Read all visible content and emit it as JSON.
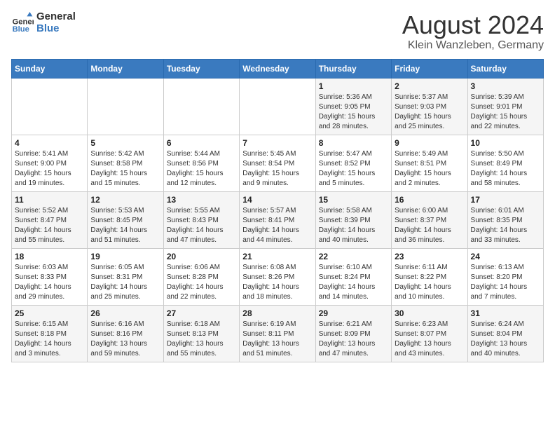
{
  "logo": {
    "line1": "General",
    "line2": "Blue"
  },
  "title": "August 2024",
  "subtitle": "Klein Wanzleben, Germany",
  "days_of_week": [
    "Sunday",
    "Monday",
    "Tuesday",
    "Wednesday",
    "Thursday",
    "Friday",
    "Saturday"
  ],
  "weeks": [
    [
      {
        "day": "",
        "info": ""
      },
      {
        "day": "",
        "info": ""
      },
      {
        "day": "",
        "info": ""
      },
      {
        "day": "",
        "info": ""
      },
      {
        "day": "1",
        "info": "Sunrise: 5:36 AM\nSunset: 9:05 PM\nDaylight: 15 hours\nand 28 minutes."
      },
      {
        "day": "2",
        "info": "Sunrise: 5:37 AM\nSunset: 9:03 PM\nDaylight: 15 hours\nand 25 minutes."
      },
      {
        "day": "3",
        "info": "Sunrise: 5:39 AM\nSunset: 9:01 PM\nDaylight: 15 hours\nand 22 minutes."
      }
    ],
    [
      {
        "day": "4",
        "info": "Sunrise: 5:41 AM\nSunset: 9:00 PM\nDaylight: 15 hours\nand 19 minutes."
      },
      {
        "day": "5",
        "info": "Sunrise: 5:42 AM\nSunset: 8:58 PM\nDaylight: 15 hours\nand 15 minutes."
      },
      {
        "day": "6",
        "info": "Sunrise: 5:44 AM\nSunset: 8:56 PM\nDaylight: 15 hours\nand 12 minutes."
      },
      {
        "day": "7",
        "info": "Sunrise: 5:45 AM\nSunset: 8:54 PM\nDaylight: 15 hours\nand 9 minutes."
      },
      {
        "day": "8",
        "info": "Sunrise: 5:47 AM\nSunset: 8:52 PM\nDaylight: 15 hours\nand 5 minutes."
      },
      {
        "day": "9",
        "info": "Sunrise: 5:49 AM\nSunset: 8:51 PM\nDaylight: 15 hours\nand 2 minutes."
      },
      {
        "day": "10",
        "info": "Sunrise: 5:50 AM\nSunset: 8:49 PM\nDaylight: 14 hours\nand 58 minutes."
      }
    ],
    [
      {
        "day": "11",
        "info": "Sunrise: 5:52 AM\nSunset: 8:47 PM\nDaylight: 14 hours\nand 55 minutes."
      },
      {
        "day": "12",
        "info": "Sunrise: 5:53 AM\nSunset: 8:45 PM\nDaylight: 14 hours\nand 51 minutes."
      },
      {
        "day": "13",
        "info": "Sunrise: 5:55 AM\nSunset: 8:43 PM\nDaylight: 14 hours\nand 47 minutes."
      },
      {
        "day": "14",
        "info": "Sunrise: 5:57 AM\nSunset: 8:41 PM\nDaylight: 14 hours\nand 44 minutes."
      },
      {
        "day": "15",
        "info": "Sunrise: 5:58 AM\nSunset: 8:39 PM\nDaylight: 14 hours\nand 40 minutes."
      },
      {
        "day": "16",
        "info": "Sunrise: 6:00 AM\nSunset: 8:37 PM\nDaylight: 14 hours\nand 36 minutes."
      },
      {
        "day": "17",
        "info": "Sunrise: 6:01 AM\nSunset: 8:35 PM\nDaylight: 14 hours\nand 33 minutes."
      }
    ],
    [
      {
        "day": "18",
        "info": "Sunrise: 6:03 AM\nSunset: 8:33 PM\nDaylight: 14 hours\nand 29 minutes."
      },
      {
        "day": "19",
        "info": "Sunrise: 6:05 AM\nSunset: 8:31 PM\nDaylight: 14 hours\nand 25 minutes."
      },
      {
        "day": "20",
        "info": "Sunrise: 6:06 AM\nSunset: 8:28 PM\nDaylight: 14 hours\nand 22 minutes."
      },
      {
        "day": "21",
        "info": "Sunrise: 6:08 AM\nSunset: 8:26 PM\nDaylight: 14 hours\nand 18 minutes."
      },
      {
        "day": "22",
        "info": "Sunrise: 6:10 AM\nSunset: 8:24 PM\nDaylight: 14 hours\nand 14 minutes."
      },
      {
        "day": "23",
        "info": "Sunrise: 6:11 AM\nSunset: 8:22 PM\nDaylight: 14 hours\nand 10 minutes."
      },
      {
        "day": "24",
        "info": "Sunrise: 6:13 AM\nSunset: 8:20 PM\nDaylight: 14 hours\nand 7 minutes."
      }
    ],
    [
      {
        "day": "25",
        "info": "Sunrise: 6:15 AM\nSunset: 8:18 PM\nDaylight: 14 hours\nand 3 minutes."
      },
      {
        "day": "26",
        "info": "Sunrise: 6:16 AM\nSunset: 8:16 PM\nDaylight: 13 hours\nand 59 minutes."
      },
      {
        "day": "27",
        "info": "Sunrise: 6:18 AM\nSunset: 8:13 PM\nDaylight: 13 hours\nand 55 minutes."
      },
      {
        "day": "28",
        "info": "Sunrise: 6:19 AM\nSunset: 8:11 PM\nDaylight: 13 hours\nand 51 minutes."
      },
      {
        "day": "29",
        "info": "Sunrise: 6:21 AM\nSunset: 8:09 PM\nDaylight: 13 hours\nand 47 minutes."
      },
      {
        "day": "30",
        "info": "Sunrise: 6:23 AM\nSunset: 8:07 PM\nDaylight: 13 hours\nand 43 minutes."
      },
      {
        "day": "31",
        "info": "Sunrise: 6:24 AM\nSunset: 8:04 PM\nDaylight: 13 hours\nand 40 minutes."
      }
    ]
  ]
}
